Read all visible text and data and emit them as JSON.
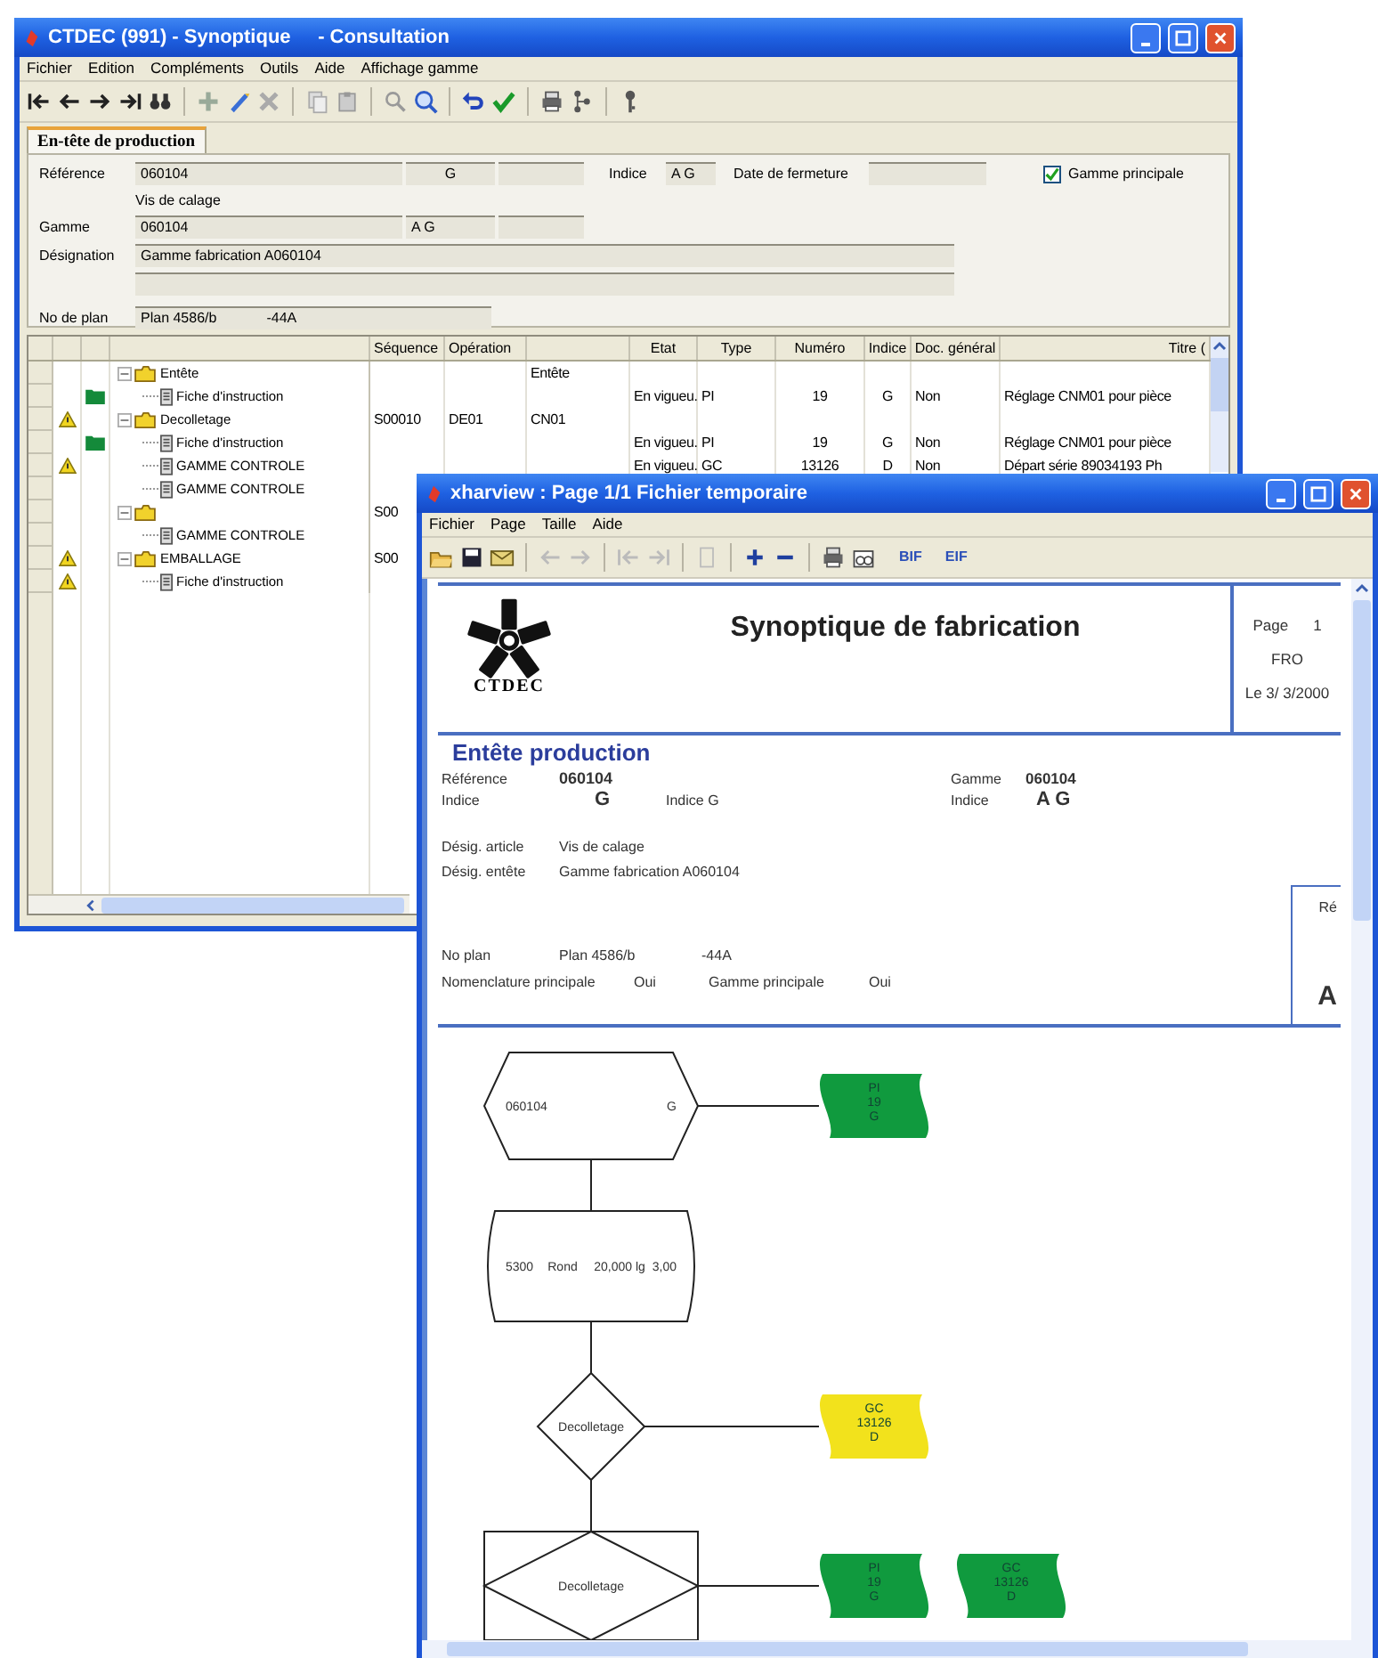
{
  "main_window": {
    "title": "CTDEC (991) - Synoptique     - Consultation",
    "menu": [
      "Fichier",
      "Edition",
      "Compléments",
      "Outils",
      "Aide",
      "Affichage gamme"
    ],
    "tab": {
      "label": "En-tête de production",
      "selected": true
    },
    "form": {
      "reference_label": "Référence",
      "reference": "060104",
      "reference_index": "G",
      "article": "Vis de calage",
      "indice_label": "Indice",
      "indice": "A G",
      "closing_date_label": "Date de fermeture",
      "main_range": {
        "label": "Gamme principale",
        "checked": true
      },
      "gamme_label": "Gamme",
      "gamme": "060104",
      "gamme_index": "A G",
      "designation_label": "Désignation",
      "designation": "Gamme fabrication A060104",
      "plan_label": "No de plan",
      "plan": "Plan 4586/b",
      "plan_suffix": "-44A"
    },
    "table": {
      "column_headers": {
        "sequence": "Séquence",
        "operation": "Opération",
        "state": "Etat",
        "type": "Type",
        "number": "Numéro",
        "index": "Indice",
        "general_doc": "Doc. général",
        "title": "Titre ("
      },
      "rows": [
        {
          "label": "Entête",
          "kind": "folder",
          "expanded": true,
          "warning": false,
          "attachment": false,
          "cells": {
            "column_4": "Entête"
          },
          "children": [
            {
              "label": "Fiche d'instruction",
              "kind": "document",
              "warning": false,
              "attachment": true,
              "cells": {
                "state": "En vigueu.",
                "type": "PI",
                "number": "19",
                "index": "G",
                "general_doc": "Non",
                "title": "Réglage CNM01 pour pièce"
              }
            }
          ]
        },
        {
          "label": "Decolletage",
          "kind": "folder",
          "expanded": true,
          "warning": true,
          "attachment": false,
          "cells": {
            "sequence": "S00010",
            "operation": "DE01",
            "column_4": "CN01"
          },
          "children": [
            {
              "label": "Fiche d'instruction",
              "kind": "document",
              "warning": false,
              "attachment": true,
              "cells": {
                "state": "En vigueu.",
                "type": "PI",
                "number": "19",
                "index": "G",
                "general_doc": "Non",
                "title": "Réglage CNM01 pour pièce"
              }
            },
            {
              "label": "GAMME CONTROLE",
              "kind": "document",
              "warning": true,
              "attachment": false,
              "cells": {
                "state": "En vigueu.",
                "type": "GC",
                "number": "13126",
                "index": "D",
                "general_doc": "Non",
                "title": "Départ série  89034193 Ph"
              }
            },
            {
              "label": "GAMME CONTROLE",
              "kind": "document",
              "warning": false,
              "attachment": false
            }
          ]
        },
        {
          "kind": "folder",
          "expanded": true,
          "warning": false,
          "attachment": false,
          "cells": {
            "sequence": "S00"
          },
          "children": [
            {
              "label": "GAMME CONTROLE",
              "kind": "document",
              "warning": false,
              "attachment": false
            }
          ]
        },
        {
          "label": "EMBALLAGE",
          "kind": "folder",
          "expanded": true,
          "warning": true,
          "attachment": false,
          "cells": {
            "sequence": "S00"
          },
          "children": [
            {
              "label": "Fiche d'instruction",
              "kind": "document",
              "warning": true,
              "attachment": false
            }
          ]
        }
      ]
    }
  },
  "preview_window": {
    "title": "xharview : Page 1/1 Fichier temporaire",
    "menu": [
      "Fichier",
      "Page",
      "Taille",
      "Aide"
    ],
    "toolbar_texts": [
      "BIF",
      "EIF"
    ],
    "logo_text": "CTDEC",
    "heading": "Synoptique de fabrication",
    "page_label": "Page",
    "page_number": "1",
    "site": "FRO",
    "date": "Le 3/ 3/2000",
    "section_title": "Entête production",
    "reference_label": "Référence",
    "reference": "060104",
    "indice_label": "Indice",
    "indice": "G",
    "indice_2": "Indice G",
    "gamme_label": "Gamme",
    "gamme": "060104",
    "gamme_indice_label": "Indice",
    "gamme_indice": "A G",
    "article_label": "Désig. article",
    "article": "Vis de calage",
    "header_label": "Désig. entête",
    "header": "Gamme fabrication A060104",
    "side_box_label": "Ré",
    "side_box_value": "A",
    "plan_label": "No plan",
    "plan": "Plan 4586/b",
    "plan_suffix": "-44A",
    "nomenclature_label": "Nomenclature principale",
    "nomenclature": "Oui",
    "main_range_label": "Gamme principale",
    "main_range": "Oui",
    "diagram": {
      "nodes": [
        {
          "kind": "hexagon",
          "texts": [
            "060104",
            "G"
          ],
          "tags": [
            {
              "color": "#109a3e",
              "lines": [
                "PI",
                "19",
                "G"
              ]
            }
          ]
        },
        {
          "kind": "rounded",
          "texts": [
            "5300",
            "Rond",
            "20,000 lg",
            "3,00"
          ]
        },
        {
          "kind": "diamond",
          "texts": [
            "Decolletage"
          ],
          "tags": [
            {
              "color": "#f2e21c",
              "lines": [
                "GC",
                "13126",
                "D"
              ]
            }
          ]
        },
        {
          "kind": "boxed_diamond",
          "texts": [
            "Decolletage"
          ],
          "tags": [
            {
              "color": "#109a3e",
              "lines": [
                "PI",
                "19",
                "G"
              ]
            },
            {
              "color": "#109a3e",
              "lines": [
                "GC",
                "13126",
                "D"
              ]
            }
          ]
        }
      ]
    }
  }
}
